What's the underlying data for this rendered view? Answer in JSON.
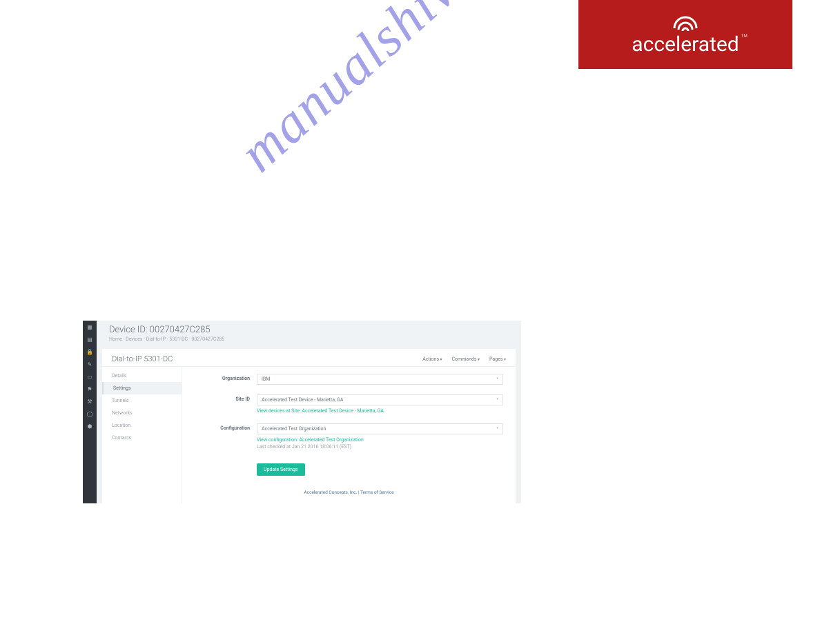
{
  "logo": {
    "text": "accelerated",
    "tm": "TM"
  },
  "watermark": "manualshive.com",
  "screenshot": {
    "device_id": "Device ID: 00270427C285",
    "breadcrumb": "Home  ·  Devices  ·  Dial-to-IP  ·  5301-DC  ·  00270427C285",
    "title": "Dial-to-IP 5301-DC",
    "action_menus": [
      "Actions",
      "Commands",
      "Pages"
    ],
    "tabs": [
      "Details",
      "Settings",
      "Tunnels",
      "Networks",
      "Location",
      "Contacts"
    ],
    "active_tab": "Settings",
    "form": {
      "organization": {
        "label": "Organization",
        "value": "IBM"
      },
      "site": {
        "label": "Site ID",
        "value": "Accelerated Test Device - Marietta, GA",
        "link": "View devices at Site: Accelerated Test Device - Marietta, GA"
      },
      "configuration": {
        "label": "Configuration",
        "value": "Accelerated Test Organization",
        "link": "View configuration: Accelerated Test Organization",
        "note": "Last checked at Jan 21 2016 18:06:11 (EST)"
      },
      "button": "Update Settings"
    },
    "footer": "Accelerated Concepts, Inc.  |  Terms of Service"
  }
}
